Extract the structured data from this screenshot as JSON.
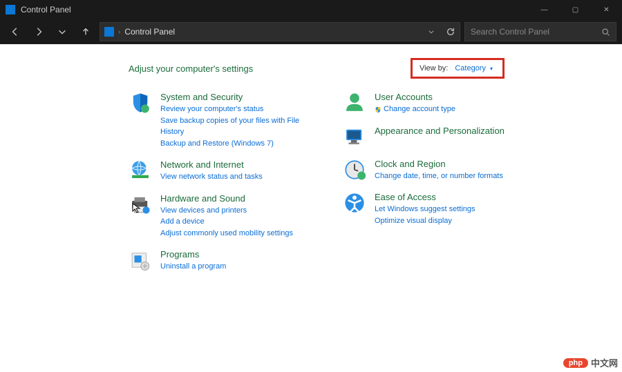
{
  "window": {
    "title": "Control Panel",
    "minimize": "—",
    "maximize": "▢",
    "close": "✕"
  },
  "nav": {
    "breadcrumb": "Control Panel",
    "search_placeholder": "Search Control Panel"
  },
  "heading": "Adjust your computer's settings",
  "viewby": {
    "label": "View by:",
    "value": "Category"
  },
  "left": [
    {
      "icon": "shield-icon",
      "title": "System and Security",
      "links": [
        {
          "text": "Review your computer's status",
          "shield": false
        },
        {
          "text": "Save backup copies of your files with File History",
          "shield": false
        },
        {
          "text": "Backup and Restore (Windows 7)",
          "shield": false
        }
      ]
    },
    {
      "icon": "globe-icon",
      "title": "Network and Internet",
      "links": [
        {
          "text": "View network status and tasks",
          "shield": false
        }
      ]
    },
    {
      "icon": "printer-icon",
      "title": "Hardware and Sound",
      "links": [
        {
          "text": "View devices and printers",
          "shield": false
        },
        {
          "text": "Add a device",
          "shield": false
        },
        {
          "text": "Adjust commonly used mobility settings",
          "shield": false
        }
      ]
    },
    {
      "icon": "programs-icon",
      "title": "Programs",
      "links": [
        {
          "text": "Uninstall a program",
          "shield": false
        }
      ]
    }
  ],
  "right": [
    {
      "icon": "user-icon",
      "title": "User Accounts",
      "links": [
        {
          "text": "Change account type",
          "shield": true
        }
      ]
    },
    {
      "icon": "appearance-icon",
      "title": "Appearance and Personalization",
      "links": []
    },
    {
      "icon": "clock-icon",
      "title": "Clock and Region",
      "links": [
        {
          "text": "Change date, time, or number formats",
          "shield": false
        }
      ]
    },
    {
      "icon": "ease-icon",
      "title": "Ease of Access",
      "links": [
        {
          "text": "Let Windows suggest settings",
          "shield": false
        },
        {
          "text": "Optimize visual display",
          "shield": false
        }
      ]
    }
  ],
  "watermark": {
    "pill": "php",
    "text": "中文网"
  }
}
